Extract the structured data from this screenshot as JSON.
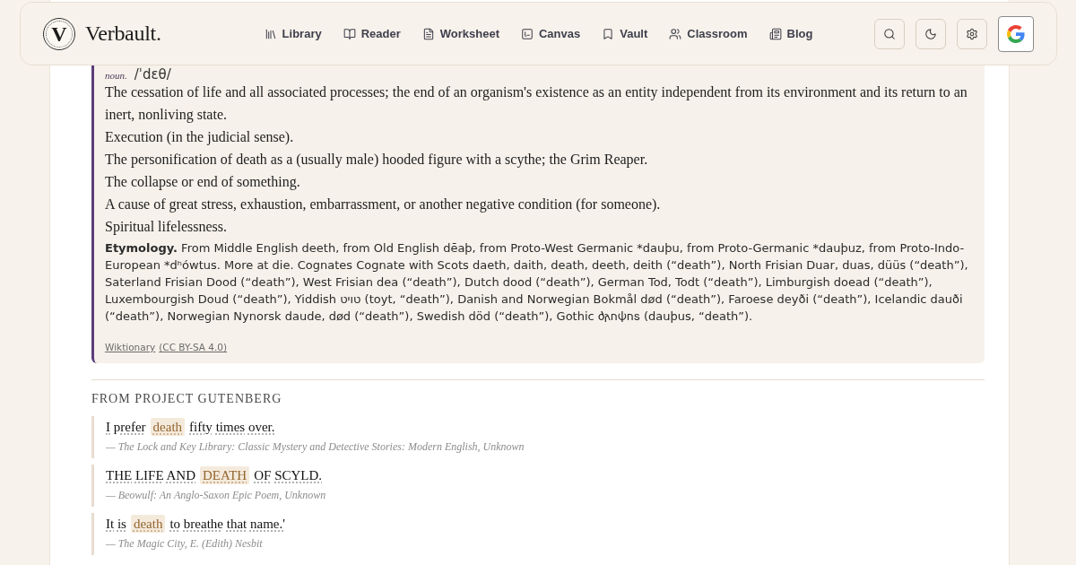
{
  "header": {
    "logo": {
      "letter": "V",
      "name": "Verbault."
    },
    "nav": [
      {
        "label": "Library"
      },
      {
        "label": "Reader"
      },
      {
        "label": "Worksheet"
      },
      {
        "label": "Canvas"
      },
      {
        "label": "Vault"
      },
      {
        "label": "Classroom"
      },
      {
        "label": "Blog"
      }
    ],
    "actions": [
      {
        "kind": "search"
      },
      {
        "kind": "theme"
      },
      {
        "kind": "settings"
      },
      {
        "kind": "google"
      }
    ]
  },
  "definition": {
    "part_of_speech": "noun.",
    "pronunciation": "/ˈdɛθ/",
    "senses": [
      "The cessation of life and all associated processes; the end of an organism's existence as an entity independent from its environment and its return to an inert, nonliving state.",
      "Execution (in the judicial sense).",
      "The personification of death as a (usually male) hooded figure with a scythe; the Grim Reaper.",
      "The collapse or end of something.",
      "A cause of great stress, exhaustion, embarrassment, or another negative condition (for someone).",
      "Spiritual lifelessness."
    ],
    "etymology": "**Etymology.** From Middle English deeth, from Old English dēaþ, from Proto-West Germanic *dauþu, from Proto-Germanic *dauþuz, from Proto-Indo-European *dʰówtus. More at die. Cognates Cognate with Scots daeth, daith, death, deeth, deith (“death”), North Frisian Duar, duas, düüs (“death”), Saterland Frisian Dood (“death”), West Frisian dea (“death”), Dutch dood (“death”), German Tod, Todt (“death”), Limburgish doead (“death”), Luxembourgish Doud (“death”), Yiddish טויט (toyt, “death”), Danish and Norwegian Bokmål død (“death”), Faroese deyði (“death”), Icelandic dauði (“death”), Norwegian Nynorsk daude, død (“death”), Swedish död (“death”), Gothic 𐌳𐌰𐌿𐌸𐌿𐍃 (dauþus, “death”).",
    "source": {
      "name": "Wiktionary",
      "license": "(CC BY-SA 4.0)"
    }
  },
  "gutenberg": {
    "heading": "FROM PROJECT GUTENBERG",
    "quotes": [
      {
        "before": "I prefer",
        "term": "death",
        "after": "fifty times over.",
        "citation": "— The Lock and Key Library: Classic Mystery and Detective Stories: Modern English, Unknown"
      },
      {
        "before": "THE LIFE AND",
        "term": "DEATH",
        "after": "OF SCYLD.",
        "citation": "— Beowulf: An Anglo-Saxon Epic Poem, Unknown"
      },
      {
        "before": "It is",
        "term": "death",
        "after": "to breathe that name.'",
        "citation": "— The Magic City, E. (Edith) Nesbit"
      }
    ]
  }
}
